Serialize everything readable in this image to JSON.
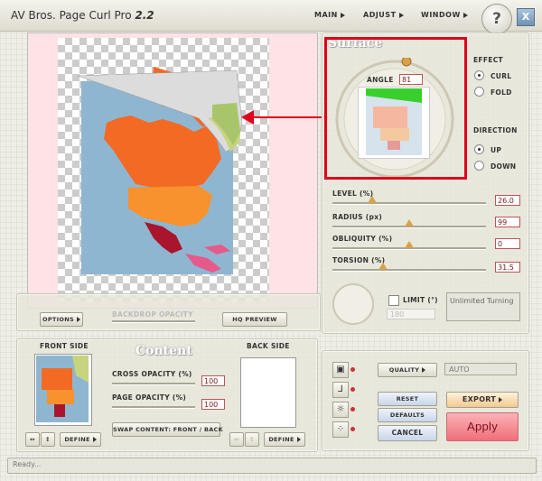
{
  "app": {
    "title_prefix": "AV Bros. Page Curl Pro",
    "version": "2.2"
  },
  "menu": {
    "main": "MAIN",
    "adjust": "ADJUST",
    "window": "WINDOW",
    "help": "?",
    "close": "X"
  },
  "preview": {
    "options": "OPTIONS",
    "backdrop_opacity": "BACKDROP OPACITY",
    "hq_preview": "HQ PREVIEW"
  },
  "surface": {
    "title": "Surface",
    "angle_label": "ANGLE",
    "angle_value": "81"
  },
  "effect": {
    "title": "EFFECT",
    "curl": "CURL",
    "fold": "FOLD",
    "selected": "curl"
  },
  "direction": {
    "title": "DIRECTION",
    "up": "UP",
    "down": "DOWN",
    "selected": "up"
  },
  "sliders": {
    "level": {
      "label": "LEVEL (%)",
      "value": "26.0",
      "fraction": 0.26
    },
    "radius": {
      "label": "RADIUS (px)",
      "value": "99",
      "fraction": 0.5
    },
    "obliquity": {
      "label": "OBLIQUITY (%)",
      "value": "0",
      "fraction": 0.5
    },
    "torsion": {
      "label": "TORSION (%)",
      "value": "31.5",
      "fraction": 0.33
    }
  },
  "limit": {
    "label": "LIMIT (°)",
    "value": "180",
    "info": "Unlimited Turning"
  },
  "content": {
    "front_side": "FRONT SIDE",
    "title": "Content",
    "back_side": "BACK SIDE",
    "cross_opacity": {
      "label": "CROSS OPACITY (%)",
      "value": "100"
    },
    "page_opacity": {
      "label": "PAGE OPACITY (%)",
      "value": "100"
    },
    "swap": "SWAP CONTENT: FRONT / BACK",
    "define_front": "DEFINE",
    "define_back": "DEFINE",
    "flip_h": "↔",
    "flip_v": "↕"
  },
  "render": {
    "quality": "QUALITY",
    "quality_value": "AUTO",
    "reset": "RESET",
    "defaults": "DEFAULTS",
    "cancel": "CANCEL",
    "export": "EXPORT",
    "apply": "Apply"
  },
  "status": {
    "text": "Ready..."
  },
  "colors": {
    "accent_red": "#e0001b",
    "apply": "#f07b82",
    "map_orange": "#f26a24",
    "sea": "#8fb6d0"
  }
}
